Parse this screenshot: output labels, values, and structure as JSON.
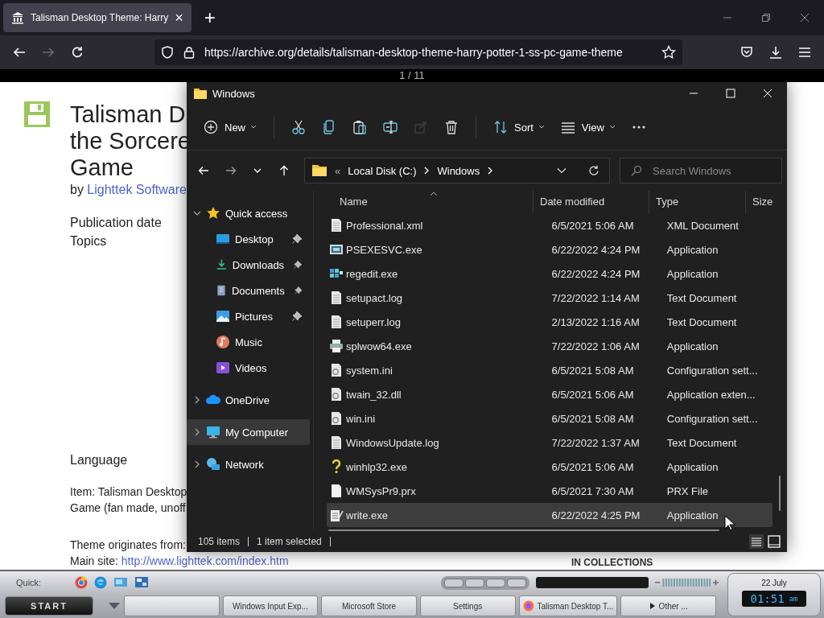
{
  "browser": {
    "tab": {
      "title": "Talisman Desktop Theme: Harry",
      "close": "×"
    },
    "new_tab": "+",
    "url": "https://archive.org/details/talisman-desktop-theme-harry-potter-1-ss-pc-game-theme",
    "page_counter": "1 / 11"
  },
  "page": {
    "title_lines": [
      "Talisman D",
      "the Sorcere",
      "Game"
    ],
    "by": "by",
    "author": "Lighttek Software",
    "meta": [
      "Publication date",
      "Topics"
    ],
    "language": "Language",
    "item_lines": [
      "Item: Talisman Desktop",
      "Game (fan made, unoff"
    ],
    "origin": "Theme originates from:",
    "site_label": "Main site:",
    "site_link": "http://www.lighttek.com/index.htm",
    "collections": "IN COLLECTIONS"
  },
  "explorer": {
    "title": "Windows",
    "toolbar": [
      {
        "kind": "new",
        "label": "New",
        "disabled": false
      },
      {
        "kind": "cut",
        "disabled": false
      },
      {
        "kind": "copy",
        "disabled": false
      },
      {
        "kind": "paste",
        "disabled": false
      },
      {
        "kind": "rename",
        "disabled": false
      },
      {
        "kind": "share",
        "disabled": true
      },
      {
        "kind": "delete",
        "disabled": false
      },
      {
        "kind": "sort",
        "label": "Sort",
        "disabled": false
      },
      {
        "kind": "view",
        "label": "View",
        "disabled": false
      },
      {
        "kind": "more",
        "disabled": false
      }
    ],
    "breadcrumb": {
      "overflow": "«",
      "parts": [
        "Local Disk (C:)",
        "Windows"
      ]
    },
    "search": {
      "placeholder": "Search Windows"
    },
    "sidebar": {
      "items": [
        {
          "label": "Quick access",
          "kind": "star",
          "expanded": true,
          "selected": false,
          "children": [
            {
              "label": "Desktop",
              "kind": "desktop",
              "pinned": true,
              "selected": false
            },
            {
              "label": "Downloads",
              "kind": "download",
              "pinned": true,
              "selected": false
            },
            {
              "label": "Documents",
              "kind": "documents",
              "pinned": true,
              "selected": false
            },
            {
              "label": "Pictures",
              "kind": "pictures",
              "pinned": true,
              "selected": false
            },
            {
              "label": "Music",
              "kind": "music",
              "pinned": false,
              "selected": false
            },
            {
              "label": "Videos",
              "kind": "videos",
              "pinned": false,
              "selected": false
            }
          ]
        },
        {
          "label": "OneDrive",
          "kind": "cloud",
          "expanded": false,
          "selected": false
        },
        {
          "label": "My Computer",
          "kind": "computer",
          "expanded": false,
          "selected": true
        },
        {
          "label": "Network",
          "kind": "network",
          "expanded": false,
          "selected": false
        }
      ]
    },
    "table": {
      "columns": [
        "Name",
        "Date modified",
        "Type",
        "Size"
      ],
      "rows": [
        {
          "name": "Professional.xml",
          "date": "6/5/2021 5:06 AM",
          "type": "XML Document",
          "kind": "document",
          "selected": false
        },
        {
          "name": "PSEXESVC.exe",
          "date": "6/22/2022 4:24 PM",
          "type": "Application",
          "kind": "app",
          "selected": false
        },
        {
          "name": "regedit.exe",
          "date": "6/22/2022 4:24 PM",
          "type": "Application",
          "kind": "registry",
          "selected": false
        },
        {
          "name": "setupact.log",
          "date": "7/22/2022 1:14 AM",
          "type": "Text Document",
          "kind": "document",
          "selected": false
        },
        {
          "name": "setuperr.log",
          "date": "2/13/2022 1:16 AM",
          "type": "Text Document",
          "kind": "document",
          "selected": false
        },
        {
          "name": "splwow64.exe",
          "date": "7/22/2022 1:06 AM",
          "type": "Application",
          "kind": "printer",
          "selected": false
        },
        {
          "name": "system.ini",
          "date": "6/5/2021 5:08 AM",
          "type": "Configuration sett...",
          "kind": "settings",
          "selected": false
        },
        {
          "name": "twain_32.dll",
          "date": "6/5/2021 5:06 AM",
          "type": "Application exten...",
          "kind": "settings",
          "selected": false
        },
        {
          "name": "win.ini",
          "date": "6/5/2021 5:08 AM",
          "type": "Configuration sett...",
          "kind": "settings",
          "selected": false
        },
        {
          "name": "WindowsUpdate.log",
          "date": "7/22/2022 1:37 AM",
          "type": "Text Document",
          "kind": "document",
          "selected": false
        },
        {
          "name": "winhlp32.exe",
          "date": "6/5/2021 5:06 AM",
          "type": "Application",
          "kind": "help",
          "selected": false
        },
        {
          "name": "WMSysPr9.prx",
          "date": "6/5/2021 7:30 AM",
          "type": "PRX File",
          "kind": "blank",
          "selected": false
        },
        {
          "name": "write.exe",
          "date": "6/22/2022 4:25 PM",
          "type": "Application",
          "kind": "write",
          "selected": true
        }
      ]
    },
    "status_bar": {
      "count": "105 items",
      "selection": "1 item selected"
    }
  },
  "taskbar": {
    "quick_label": "Quick:",
    "start": "START",
    "tasks": [
      {
        "kind": "plain"
      },
      {
        "label": "Windows Input Exp...",
        "kind": "plain"
      },
      {
        "label": "Microsoft Store",
        "kind": "plain"
      },
      {
        "label": "Settings",
        "kind": "plain"
      },
      {
        "label": "Talisman Desktop T...",
        "kind": "browser"
      },
      {
        "label": "Other ...",
        "kind": "more"
      }
    ],
    "date": "22 July",
    "time": "01:51",
    "meridiem": "am"
  }
}
